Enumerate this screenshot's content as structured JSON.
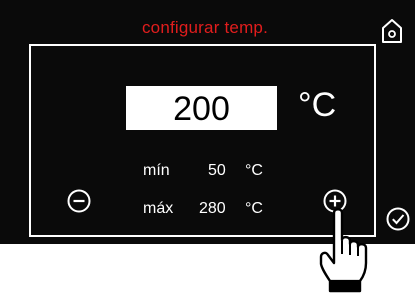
{
  "title": "configurar temp.",
  "setpoint": {
    "value": "200",
    "unit": "°C"
  },
  "limits": {
    "min_label": "mín",
    "min_value": "50",
    "min_unit": "°C",
    "max_label": "máx",
    "max_value": "280",
    "max_unit": "°C"
  },
  "icons": {
    "home": "home-icon",
    "minus": "minus-circle-icon",
    "plus": "plus-circle-icon",
    "confirm": "check-circle-icon",
    "pointer": "pointing-hand-icon"
  },
  "colors": {
    "title": "#e11d1d",
    "background": "#0a0a0a",
    "foreground": "#ffffff"
  }
}
